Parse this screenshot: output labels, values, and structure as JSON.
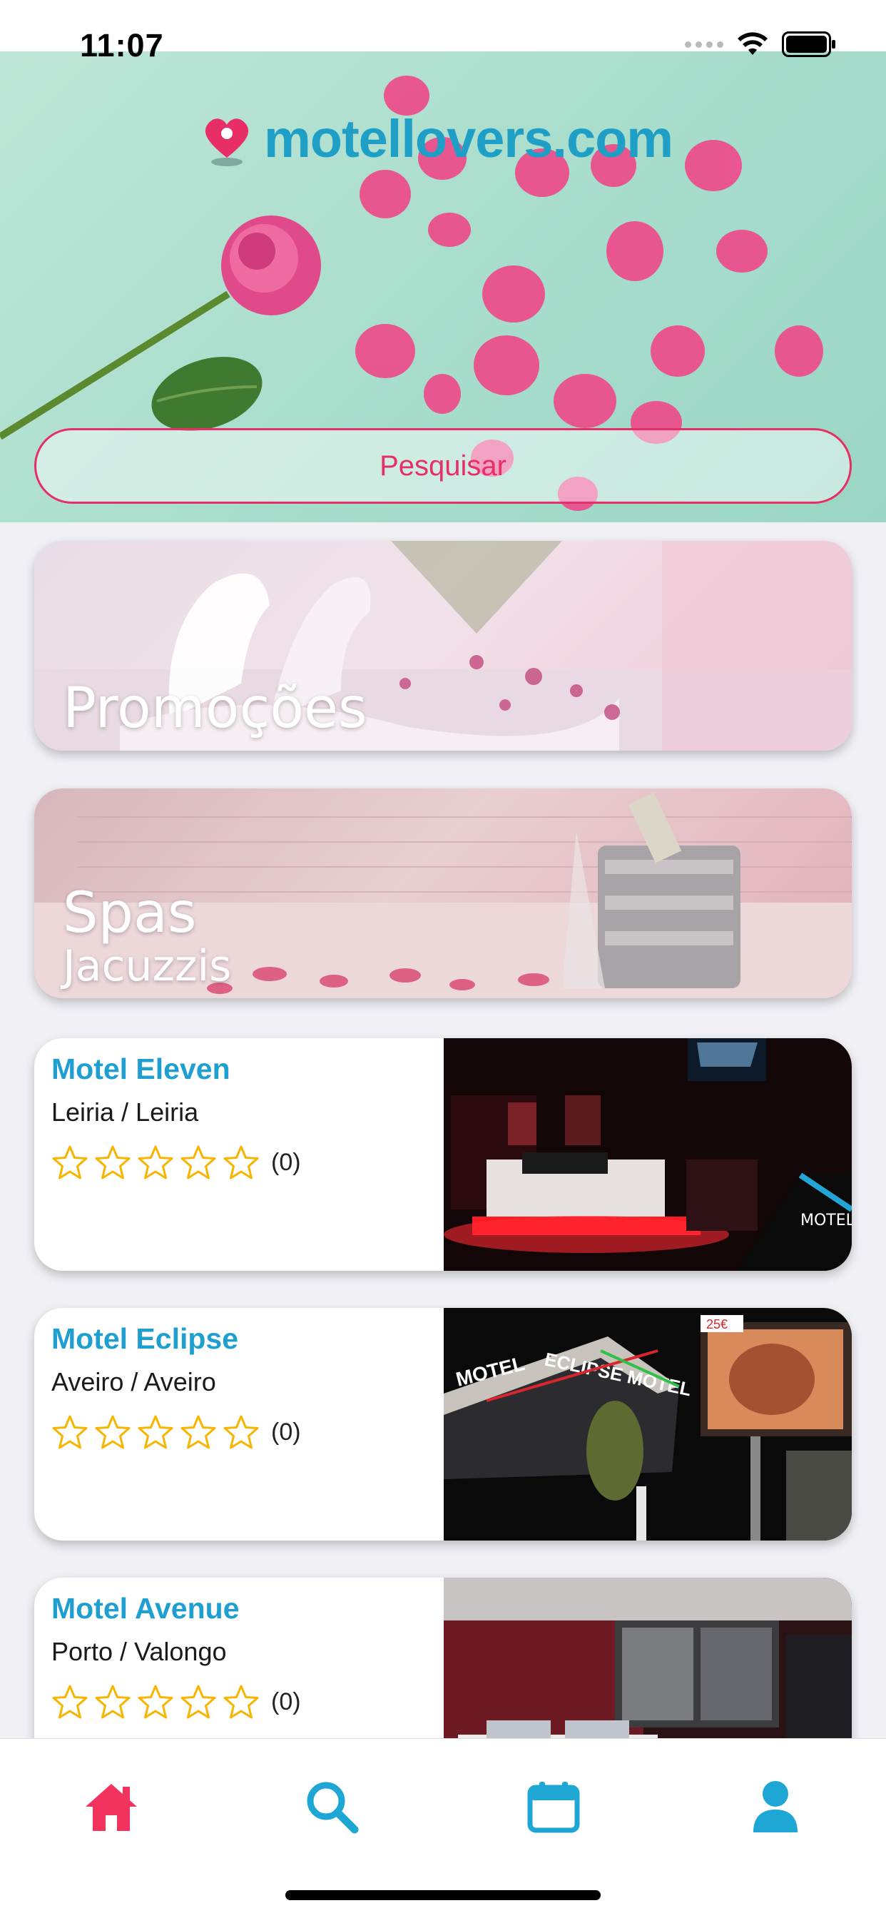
{
  "status_bar": {
    "time": "11:07"
  },
  "brand": {
    "name": "motellovers.com",
    "color": "#1f9fc6",
    "accent": "#e82e67"
  },
  "search": {
    "label": "Pesquisar"
  },
  "categories": [
    {
      "title": "Promoções"
    },
    {
      "title": "Spas",
      "subtitle": "Jacuzzis"
    }
  ],
  "motels": [
    {
      "name": "Motel Eleven",
      "location": "Leiria / Leiria",
      "rating_count": "(0)",
      "stars": 0,
      "photo_brand": "MOTEL ELEVEN"
    },
    {
      "name": "Motel Eclipse",
      "location": "Aveiro / Aveiro",
      "rating_count": "(0)",
      "stars": 0,
      "photo_signs": [
        "MOTEL",
        "ECLIPSE MOTEL"
      ],
      "photo_price": "25€"
    },
    {
      "name": "Motel Avenue",
      "location": "Porto / Valongo",
      "rating_count": "(0)",
      "stars": 0
    }
  ],
  "tab_bar": {
    "items": [
      {
        "icon": "home-icon",
        "active": true
      },
      {
        "icon": "search-icon",
        "active": false
      },
      {
        "icon": "calendar-icon",
        "active": false
      },
      {
        "icon": "user-icon",
        "active": false
      }
    ],
    "active_color": "#f2335e",
    "inactive_color": "#1ea6d4"
  }
}
